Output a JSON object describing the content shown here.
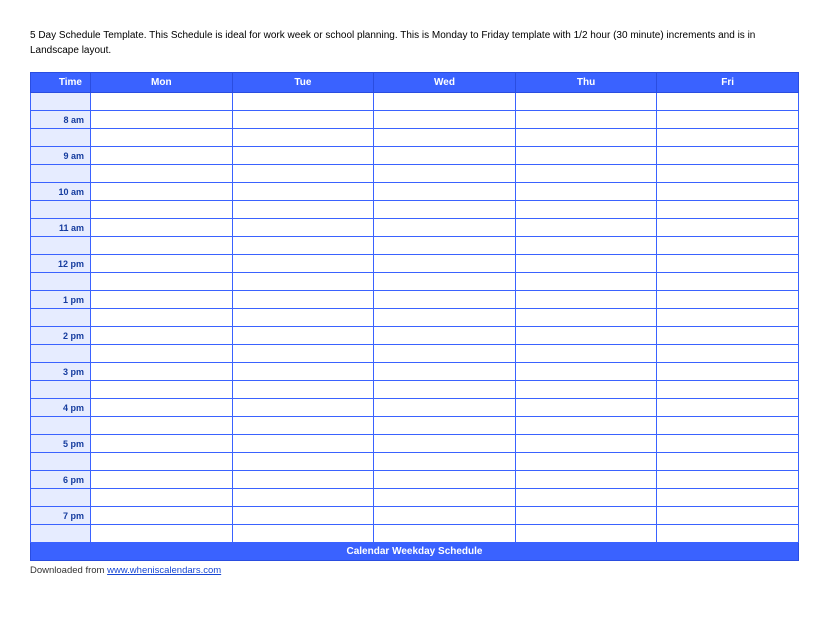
{
  "intro": "5 Day Schedule Template.  This Schedule is ideal for work week or school planning.  This is Monday to Friday template with 1/2 hour (30 minute) increments and is in Landscape layout.",
  "headers": {
    "time": "Time",
    "days": [
      "Mon",
      "Tue",
      "Wed",
      "Thu",
      "Fri"
    ]
  },
  "times": [
    "8 am",
    "9 am",
    "10 am",
    "11 am",
    "12 pm",
    "1 pm",
    "2 pm",
    "3 pm",
    "4 pm",
    "5 pm",
    "6 pm",
    "7 pm"
  ],
  "footer_title": "Calendar Weekday Schedule",
  "download": {
    "prefix": "Downloaded from ",
    "link_text": "www.wheniscalendars.com",
    "href": "http://www.wheniscalendars.com"
  }
}
